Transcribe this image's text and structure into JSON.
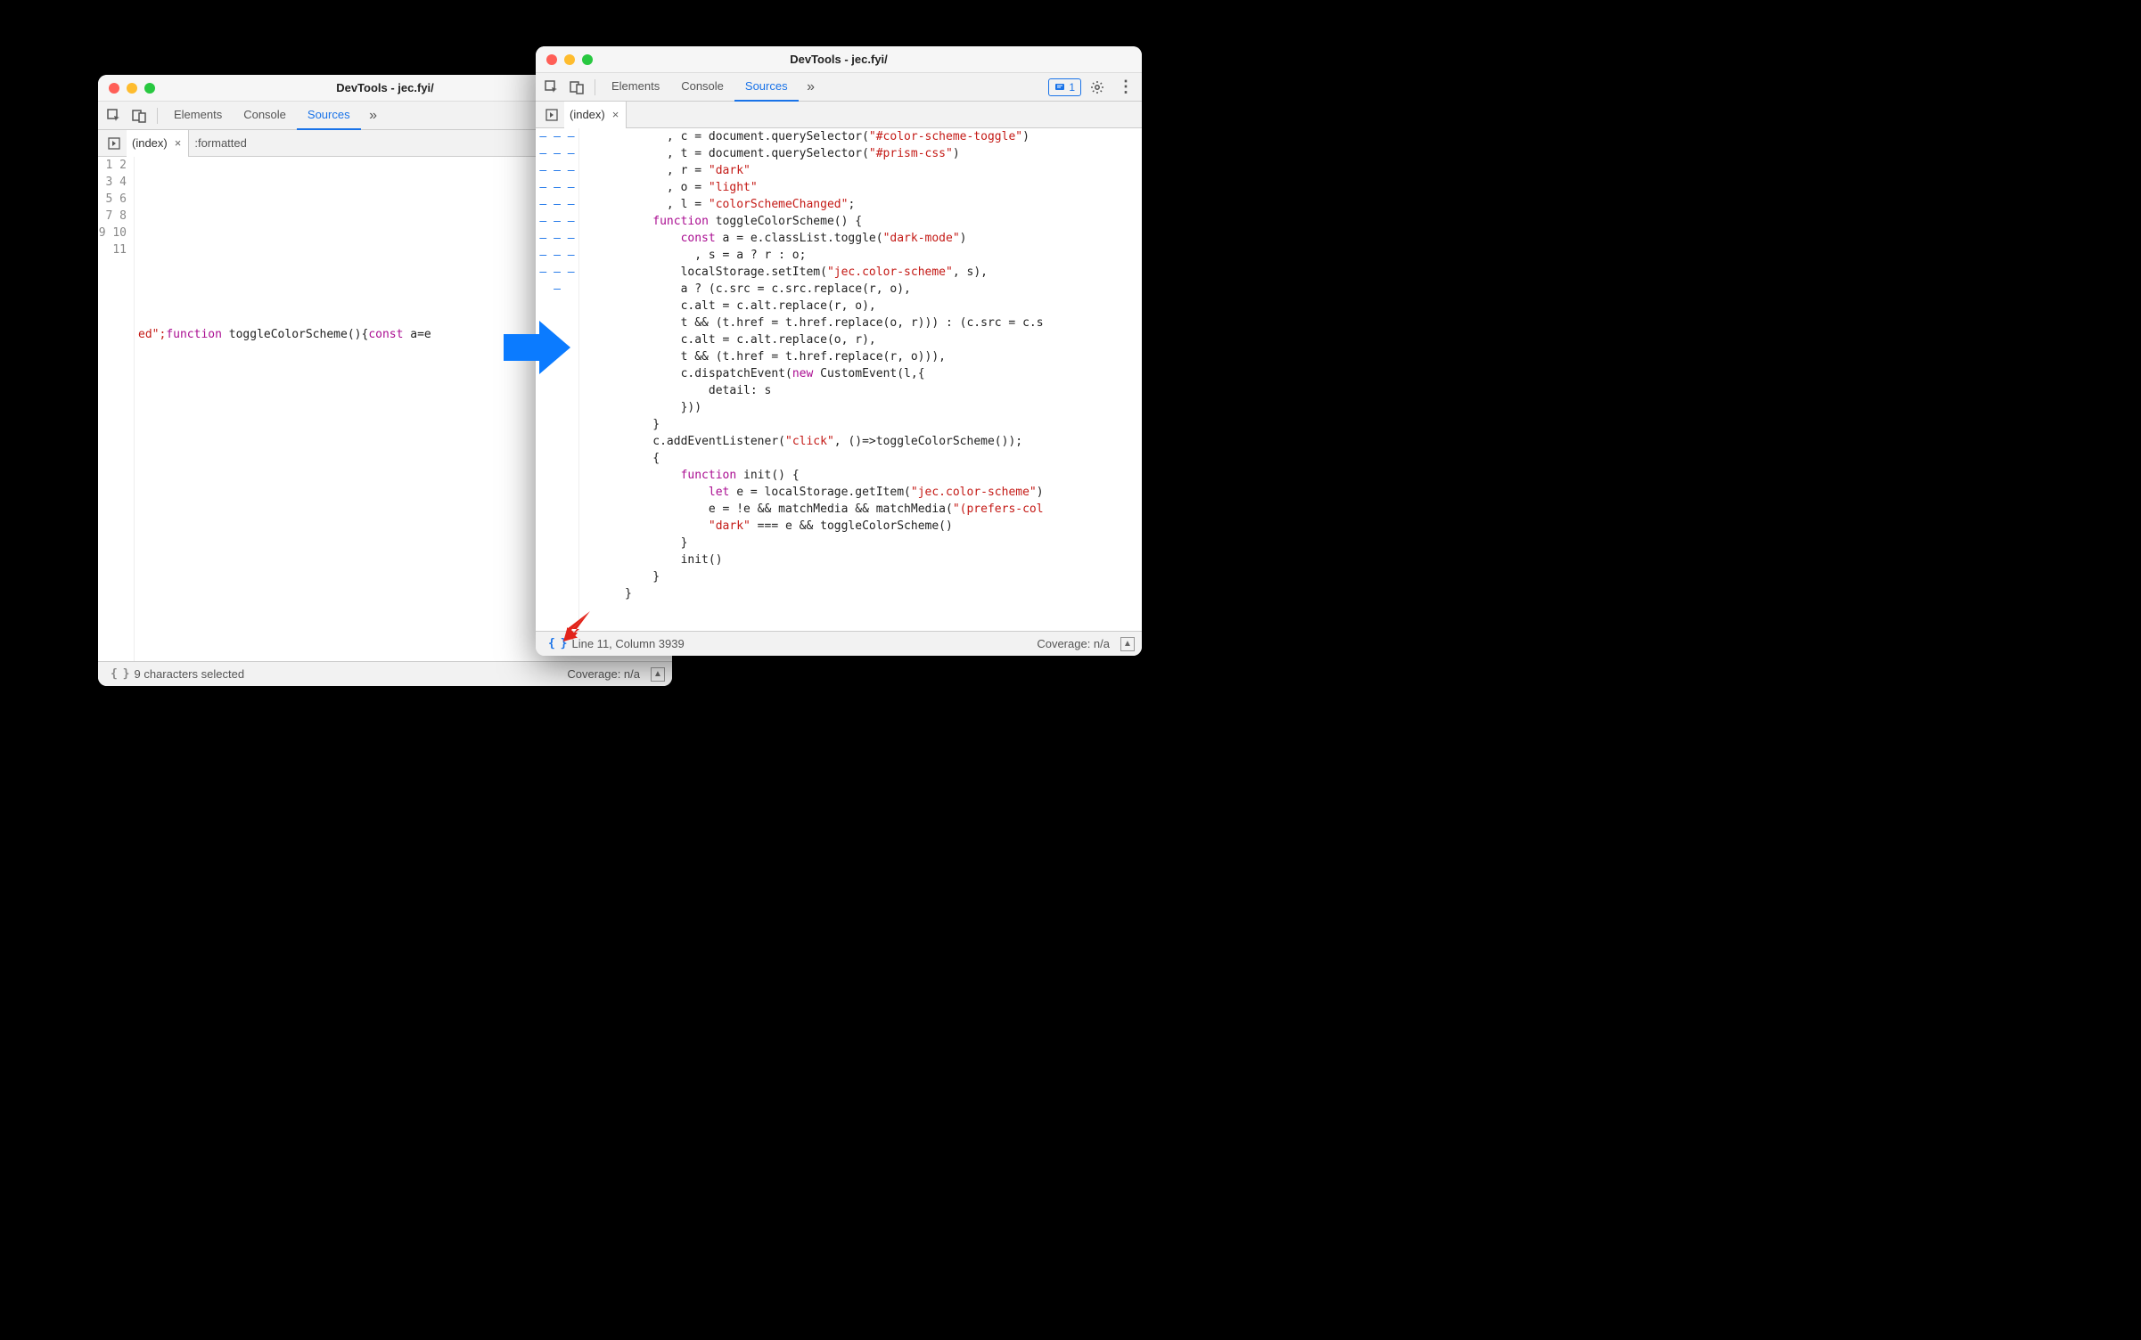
{
  "windowA": {
    "title": "DevTools - jec.fyi/",
    "tabs": {
      "elements": "Elements",
      "console": "Console",
      "sources": "Sources"
    },
    "fileTab": "(index)",
    "formattedTab": ":formatted",
    "lineNumbers": [
      "1",
      "2",
      "3",
      "4",
      "5",
      "6",
      "7",
      "8",
      "9",
      "10",
      "11"
    ],
    "code11_pre": "ed\";",
    "code11_fn": "function",
    "code11_name": " toggleColorScheme(){",
    "code11_const": "const",
    "code11_tail": " a=e",
    "status": "9 characters selected",
    "coverage": "Coverage: n/a"
  },
  "windowB": {
    "title": "DevTools - jec.fyi/",
    "tabs": {
      "elements": "Elements",
      "console": "Console",
      "sources": "Sources"
    },
    "issuesCount": "1",
    "fileTab": "(index)",
    "statusLine": "Line 11, Column 3939",
    "coverage": "Coverage: n/a",
    "code": [
      {
        "indent": "            , ",
        "n": "c = document.querySelector(",
        "s": "\"#color-scheme-toggle\"",
        "t": ")"
      },
      {
        "indent": "            , ",
        "n": "t = document.querySelector(",
        "s": "\"#prism-css\"",
        "t": ")"
      },
      {
        "indent": "            , ",
        "n": "r = ",
        "s": "\"dark\"",
        "t": ""
      },
      {
        "indent": "            , ",
        "n": "o = ",
        "s": "\"light\"",
        "t": ""
      },
      {
        "indent": "            , ",
        "n": "l = ",
        "s": "\"colorSchemeChanged\"",
        "t": ";"
      },
      {
        "indent": "          ",
        "kw": "function",
        "n": " toggleColorScheme() {"
      },
      {
        "indent": "              ",
        "kw": "const",
        "n": " a = e.classList.toggle(",
        "s": "\"dark-mode\"",
        "t": ")"
      },
      {
        "indent": "                , ",
        "n": "s = a ? r : o;"
      },
      {
        "indent": "              ",
        "n": "localStorage.setItem(",
        "s": "\"jec.color-scheme\"",
        "t": ", s),"
      },
      {
        "indent": "              ",
        "n": "a ? (c.src = c.src.replace(r, o),"
      },
      {
        "indent": "              ",
        "n": "c.alt = c.alt.replace(r, o),"
      },
      {
        "indent": "              ",
        "n": "t && (t.href = t.href.replace(o, r))) : (c.src = c.s"
      },
      {
        "indent": "              ",
        "n": "c.alt = c.alt.replace(o, r),"
      },
      {
        "indent": "              ",
        "n": "t && (t.href = t.href.replace(r, o))),"
      },
      {
        "indent": "              ",
        "n": "c.dispatchEvent(",
        "kw2": "new",
        "n2": " CustomEvent(l,{"
      },
      {
        "indent": "                  ",
        "n": "detail: s"
      },
      {
        "indent": "              ",
        "n": "}))"
      },
      {
        "indent": "          ",
        "n": "}"
      },
      {
        "indent": "          ",
        "n": "c.addEventListener(",
        "s": "\"click\"",
        "t": ", ()=>toggleColorScheme());"
      },
      {
        "indent": "          ",
        "n": "{"
      },
      {
        "indent": "              ",
        "kw": "function",
        "n": " init() {"
      },
      {
        "indent": "                  ",
        "kw": "let",
        "n": " e = localStorage.getItem(",
        "s": "\"jec.color-scheme\"",
        "t": ")"
      },
      {
        "indent": "                  ",
        "n": "e = !e && matchMedia && matchMedia(",
        "s": "\"(prefers-col",
        "t": ""
      },
      {
        "indent": "                  ",
        "s": "\"dark\"",
        "n2": " === e && toggleColorScheme()"
      },
      {
        "indent": "              ",
        "n": "}"
      },
      {
        "indent": "              ",
        "n": "init()"
      },
      {
        "indent": "          ",
        "n": "}"
      },
      {
        "indent": "      ",
        "n": "}"
      }
    ]
  }
}
